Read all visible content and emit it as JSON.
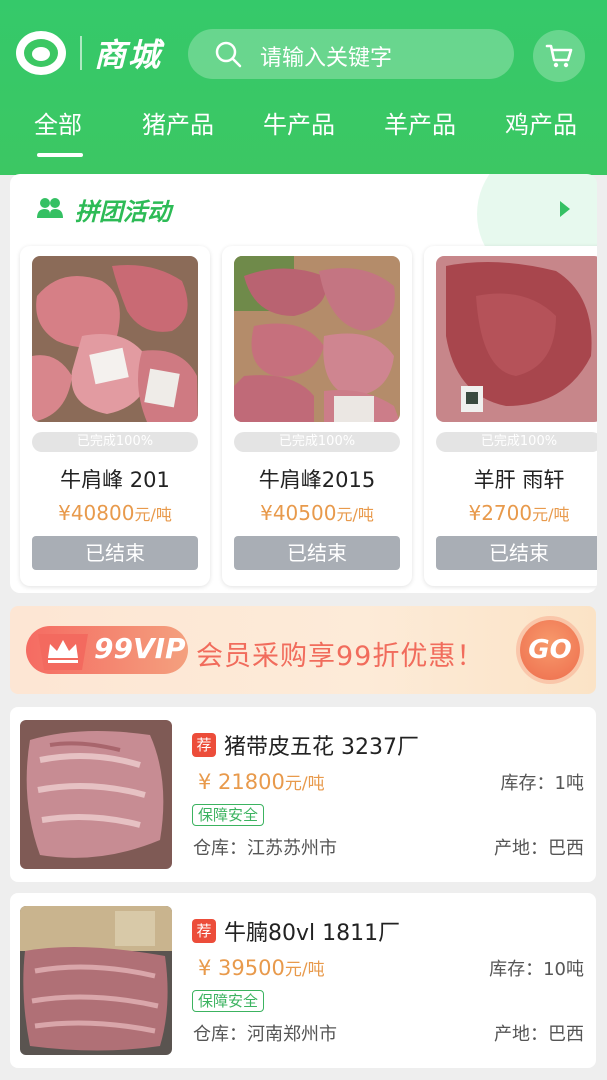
{
  "header": {
    "brand": "商城",
    "search_placeholder": "请输入关键字"
  },
  "tabs": [
    {
      "label": "全部",
      "active": true
    },
    {
      "label": "猪产品"
    },
    {
      "label": "牛产品"
    },
    {
      "label": "羊产品"
    },
    {
      "label": "鸡产品"
    }
  ],
  "group_buy": {
    "title": "拼团活动",
    "products": [
      {
        "progress": "已完成100%",
        "name": "牛肩峰 201",
        "price": "¥40800",
        "unit": "元/吨",
        "button": "已结束"
      },
      {
        "progress": "已完成100%",
        "name": "牛肩峰2015",
        "price": "¥40500",
        "unit": "元/吨",
        "button": "已结束"
      },
      {
        "progress": "已完成100%",
        "name": "羊肝 雨轩",
        "price": "¥2700",
        "unit": "元/吨",
        "button": "已结束"
      }
    ]
  },
  "vip_banner": {
    "badge": "99VIP",
    "slogan": "会员采购享99折优惠！",
    "go": "GO"
  },
  "listings": [
    {
      "tag": "荐",
      "title": "猪带皮五花 3237厂",
      "price": "¥ 21800",
      "unit": "元/吨",
      "stock": "库存：1吨",
      "safety": "保障安全",
      "warehouse": "仓库：江苏苏州市",
      "origin": "产地：巴西"
    },
    {
      "tag": "荐",
      "title": "牛腩80vl 1811厂",
      "price": "¥ 39500",
      "unit": "元/吨",
      "stock": "库存：10吨",
      "safety": "保障安全",
      "warehouse": "仓库：河南郑州市",
      "origin": "产地：巴西"
    }
  ],
  "colors": {
    "brand_green": "#3cc763",
    "price_orange": "#e89a4c",
    "ended_gray": "#a9aeb5",
    "tag_red": "#ec4d3a"
  }
}
